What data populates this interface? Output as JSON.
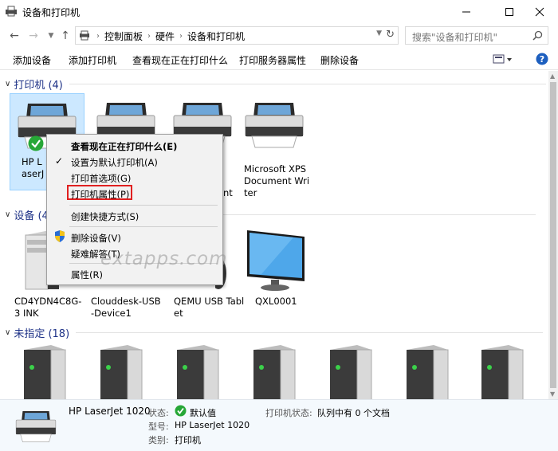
{
  "window": {
    "title": "设备和打印机"
  },
  "address": {
    "crumbs": [
      "控制面板",
      "硬件",
      "设备和打印机"
    ]
  },
  "search": {
    "placeholder": "搜索\"设备和打印机\""
  },
  "toolbar": {
    "items": [
      "添加设备",
      "添加打印机",
      "查看现在正在打印什么",
      "打印服务器属性",
      "删除设备"
    ]
  },
  "groups": {
    "printers": "打印机 (4)",
    "devices": "设备 (4)",
    "unspecified": "未指定 (18)"
  },
  "printers": [
    {
      "label": "HP LaserJet 1020"
    },
    {
      "label": ""
    },
    {
      "label": "nt"
    },
    {
      "label": "Microsoft XPS Document Writer"
    }
  ],
  "devices": [
    {
      "label": "CD4YDN4C8G-3 INK"
    },
    {
      "label": "Clouddesk-USB -Device1"
    },
    {
      "label": "QEMU USB Tablet"
    },
    {
      "label": "QXL0001"
    }
  ],
  "context_menu": {
    "items": [
      "查看现在正在打印什么(E)",
      "设置为默认打印机(A)",
      "打印首选项(G)",
      "打印机属性(P)",
      "创建快捷方式(S)",
      "删除设备(V)",
      "疑难解答(T)",
      "属性(R)"
    ]
  },
  "watermark": "extapps.com",
  "details": {
    "name": "HP LaserJet 1020",
    "status_key": "状态:",
    "status_value": "默认值",
    "model_key": "型号:",
    "model_value": "HP LaserJet 1020",
    "category_key": "类别:",
    "category_value": "打印机",
    "printer_status_key": "打印机状态:",
    "printer_status_value": "队列中有 0 个文档"
  }
}
